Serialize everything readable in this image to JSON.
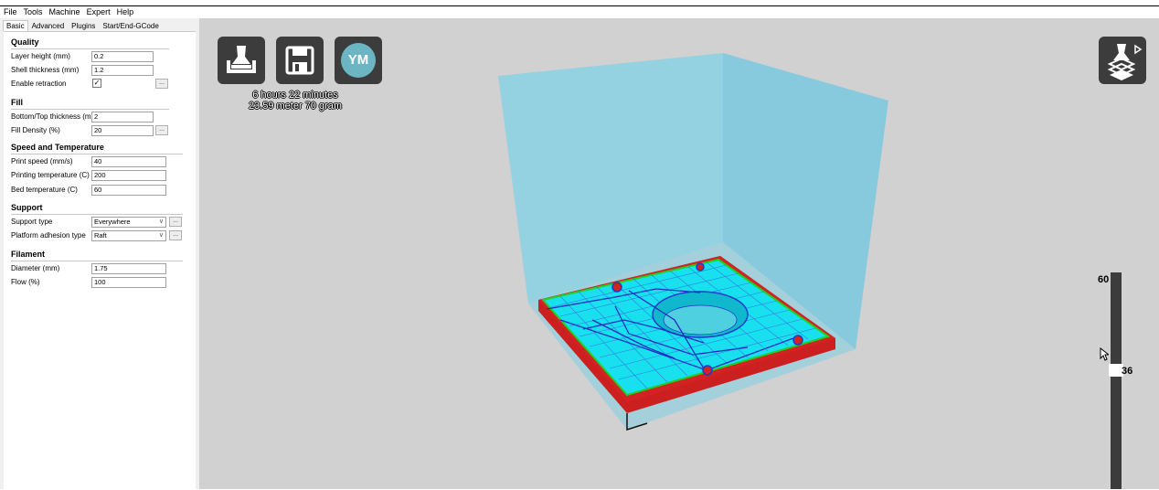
{
  "menu": [
    "File",
    "Tools",
    "Machine",
    "Expert",
    "Help"
  ],
  "tabs": [
    "Basic",
    "Advanced",
    "Plugins",
    "Start/End-GCode"
  ],
  "sections": {
    "quality": "Quality",
    "fill": "Fill",
    "speed": "Speed and Temperature",
    "support": "Support",
    "filament": "Filament"
  },
  "fields": {
    "layer_height": {
      "label": "Layer height (mm)",
      "value": "0.2"
    },
    "shell_thickness": {
      "label": "Shell thickness (mm)",
      "value": "1.2"
    },
    "enable_retraction": {
      "label": "Enable retraction",
      "checked": true
    },
    "bottom_top_thickness": {
      "label": "Bottom/Top thickness (mm)",
      "value": "2"
    },
    "fill_density": {
      "label": "Fill Density (%)",
      "value": "20"
    },
    "print_speed": {
      "label": "Print speed (mm/s)",
      "value": "40"
    },
    "printing_temperature": {
      "label": "Printing temperature (C)",
      "value": "200"
    },
    "bed_temperature": {
      "label": "Bed temperature (C)",
      "value": "60"
    },
    "support_type": {
      "label": "Support type",
      "value": "Everywhere"
    },
    "platform_adhesion": {
      "label": "Platform adhesion type",
      "value": "Raft"
    },
    "diameter": {
      "label": "Diameter (mm)",
      "value": "1.75"
    },
    "flow": {
      "label": "Flow (%)",
      "value": "100"
    }
  },
  "more_button": "...",
  "checkmark": "✓",
  "viewport": {
    "ym_label": "YM",
    "print_time": "6 hours 22 minutes",
    "print_material": "23.59 meter 70 gram",
    "layer_max": "60",
    "layer_current": "36"
  },
  "icons": [
    "load-model-icon",
    "save-gcode-icon",
    "youmagine-icon",
    "view-mode-icon",
    "mouse-cursor-icon"
  ],
  "colors": {
    "viewport_bg": "#d1d1d1",
    "build_volume": "#7fd0e6",
    "raft": "#cc1f1f",
    "infill": "#00e0f0",
    "travel": "#1f3fd0",
    "button_bg": "#3c3c3c"
  }
}
